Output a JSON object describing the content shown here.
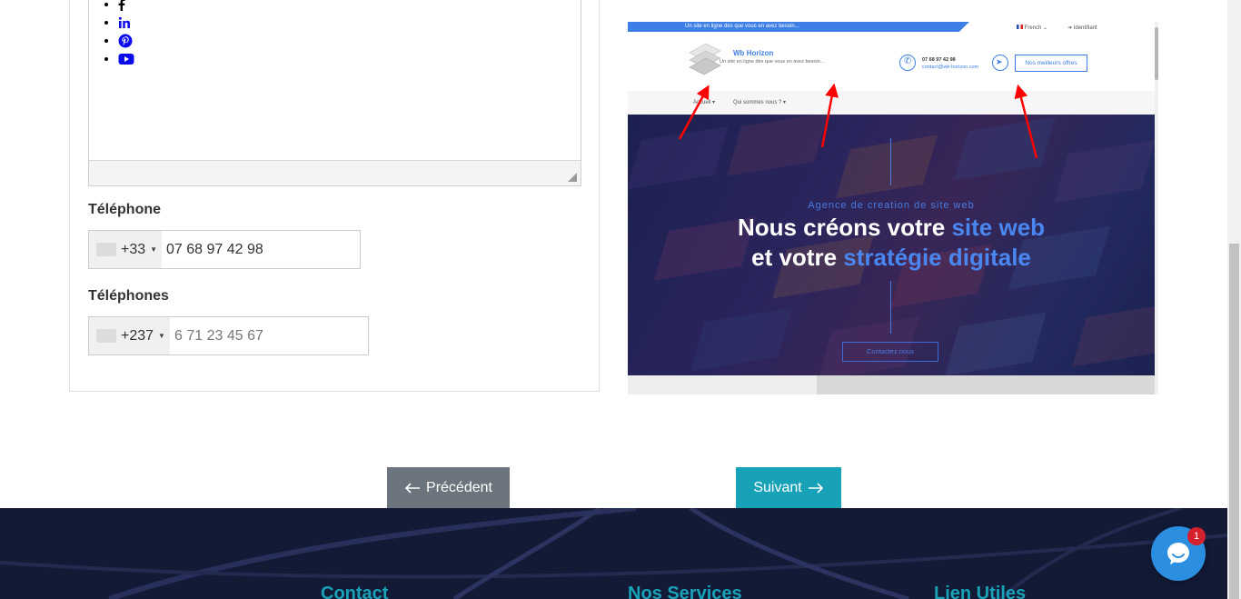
{
  "form": {
    "social_icons": [
      "facebook-icon",
      "linkedin-icon",
      "pinterest-icon",
      "youtube-icon"
    ],
    "telephone": {
      "label": "Téléphone",
      "country_code": "+33",
      "value": "07 68 97 42 98"
    },
    "telephones": {
      "label": "Téléphones",
      "country_code": "+237",
      "placeholder": "6 71 23 45 67"
    }
  },
  "preview": {
    "topbar_text": "Un site en ligne dès que vous en avez besoin...",
    "language": "French",
    "login": "Identifiant",
    "brand_name": "Wb Horizon",
    "brand_tagline": "Un site en ligne dès que vous en avez besoin...",
    "phone": "07 68 97 42 98",
    "email": "contact@wb-horizon.com",
    "offers_button": "Nos meilleurs offres",
    "nav_item_2": "Qui sommes nous ?",
    "hero_kicker": "Agence de creation de site web",
    "hero_line1_a": "Nous créons votre ",
    "hero_line1_b": "site web",
    "hero_line2_a": "et votre ",
    "hero_line2_b": "stratégie digitale",
    "hero_button": "Contactez nous"
  },
  "navigation": {
    "previous": "Précédent",
    "next": "Suivant"
  },
  "footer": {
    "col1": "Contact",
    "col2": "Nos Services",
    "col3": "Lien Utiles"
  },
  "chat": {
    "badge_count": "1"
  },
  "colors": {
    "accent": "#17a2b8",
    "previous_bg": "#6c757d",
    "footer_bg": "#121a36",
    "brand_blue": "#3d7fe6"
  }
}
